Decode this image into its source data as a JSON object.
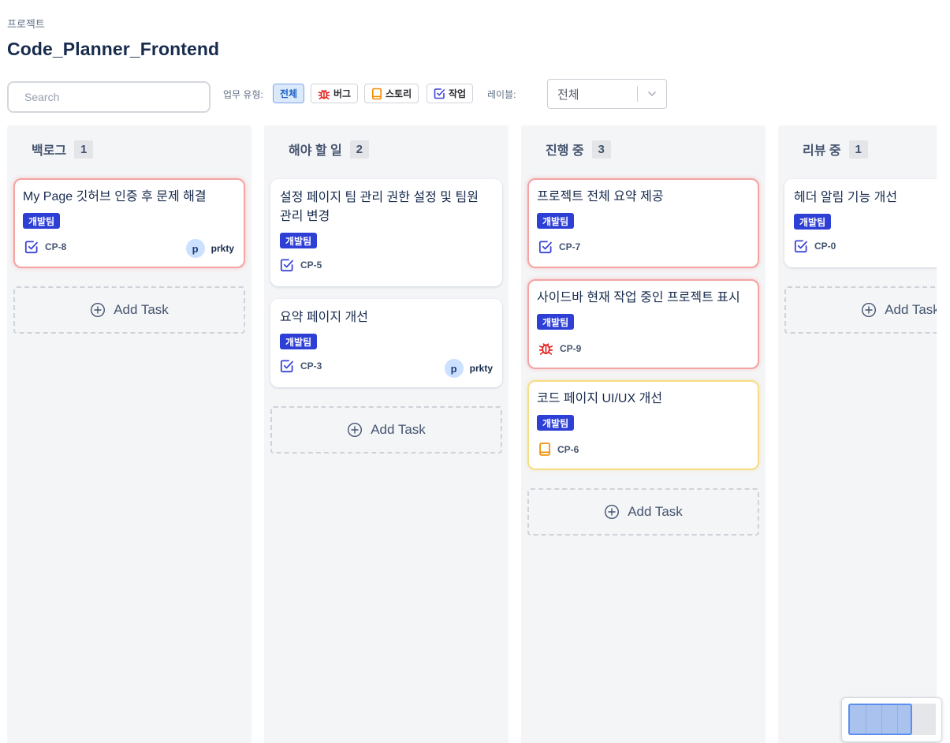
{
  "breadcrumb": "프로젝트",
  "title": "Code_Planner_Frontend",
  "search": {
    "placeholder": "Search"
  },
  "filters": {
    "type_label": "업무 유형:",
    "types": [
      {
        "label": "전체",
        "icon": "none",
        "active": true
      },
      {
        "label": "버그",
        "icon": "bug-icon",
        "active": false
      },
      {
        "label": "스토리",
        "icon": "story-icon",
        "active": false
      },
      {
        "label": "작업",
        "icon": "task-icon",
        "active": false
      }
    ],
    "label_label": "레이블:",
    "label_value": "전체"
  },
  "colors": {
    "bug": "#e2211c",
    "story": "#f08c00",
    "task": "#3b45d6",
    "badge": "#2e3fd6",
    "highlight_red": "#f5a3a3",
    "highlight_yellow": "#f7dc86"
  },
  "add_task_label": "Add Task",
  "columns": [
    {
      "title": "백로그",
      "count": "1",
      "cards": [
        {
          "title": "My Page 깃허브 인증 후 문제 해결",
          "label": "개발팀",
          "type": "task",
          "key": "CP-8",
          "assignee_initial": "p",
          "assignee": "prkty",
          "highlight": "red"
        }
      ]
    },
    {
      "title": "해야 할 일",
      "count": "2",
      "cards": [
        {
          "title": "설정 페이지 팀 관리 권한 설정 및 팀원 관리 변경",
          "label": "개발팀",
          "type": "task",
          "key": "CP-5",
          "highlight": "none"
        },
        {
          "title": "요약 페이지 개선",
          "label": "개발팀",
          "type": "task",
          "key": "CP-3",
          "assignee_initial": "p",
          "assignee": "prkty",
          "highlight": "none"
        }
      ]
    },
    {
      "title": "진행 중",
      "count": "3",
      "cards": [
        {
          "title": "프로젝트 전체 요약 제공",
          "label": "개발팀",
          "type": "task",
          "key": "CP-7",
          "highlight": "red"
        },
        {
          "title": "사이드바 현재 작업 중인 프로젝트 표시",
          "label": "개발팀",
          "type": "bug",
          "key": "CP-9",
          "highlight": "red"
        },
        {
          "title": "코드 페이지 UI/UX 개선",
          "label": "개발팀",
          "type": "story",
          "key": "CP-6",
          "highlight": "yellow"
        }
      ]
    },
    {
      "title": "리뷰 중",
      "count": "1",
      "cards": [
        {
          "title": "헤더 알림 기능 개선",
          "label": "개발팀",
          "type": "task",
          "key": "CP-0",
          "highlight": "none"
        }
      ]
    }
  ]
}
